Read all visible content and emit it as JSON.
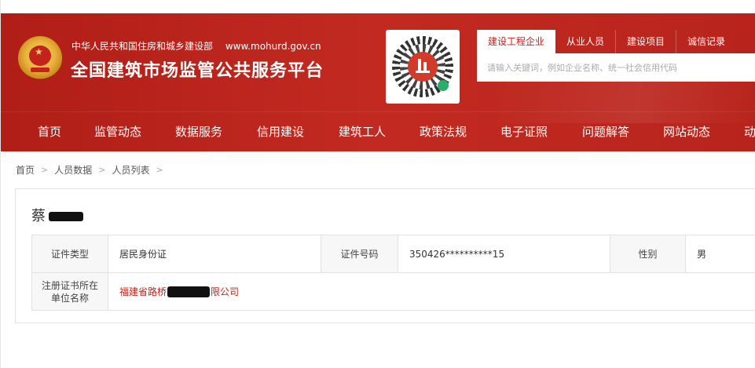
{
  "header": {
    "ministry": "中华人民共和国住房和城乡建设部",
    "url": "www.mohurd.gov.cn",
    "platform_title": "全国建筑市场监管公共服务平台",
    "brand_color": "#c2231b"
  },
  "search": {
    "tabs": [
      "建设工程企业",
      "从业人员",
      "建设项目",
      "诚信记录"
    ],
    "active_tab": "建设工程企业",
    "placeholder": "请输入关键词，例如企业名称、统一社会信用代码"
  },
  "nav": {
    "items": [
      "首页",
      "监管动态",
      "数据服务",
      "信用建设",
      "建筑工人",
      "政策法规",
      "电子证照",
      "问题解答",
      "网站动态",
      "动"
    ]
  },
  "breadcrumb": [
    "首页",
    "人员数据",
    "人员列表"
  ],
  "person": {
    "surname": "蔡",
    "id_type_label": "证件类型",
    "id_type": "居民身份证",
    "id_number_label": "证件号码",
    "id_number": "350426**********15",
    "gender_label": "性别",
    "gender": "男",
    "employer_label_line1": "注册证书所在",
    "employer_label_line2": "单位名称",
    "employer_prefix": "福建省路桥",
    "employer_suffix": "限公司"
  },
  "icons": {
    "emblem": "national-emblem-icon",
    "qr": "mini-program-qr-icon",
    "breadcrumb_separator": "chevron-right-icon"
  }
}
